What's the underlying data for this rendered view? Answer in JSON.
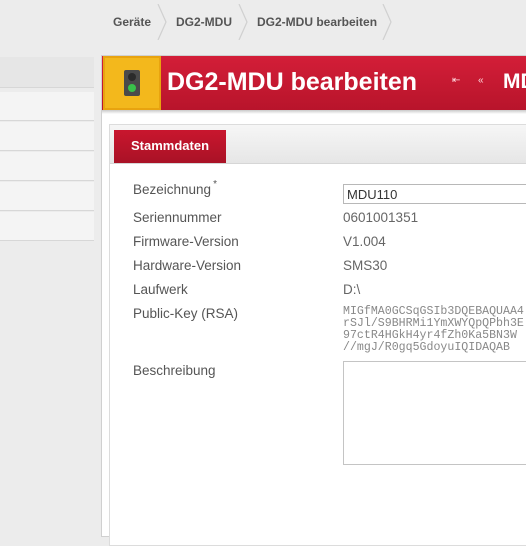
{
  "breadcrumb": {
    "items": [
      "Geräte",
      "DG2-MDU",
      "DG2-MDU bearbeiten"
    ]
  },
  "header": {
    "title": "DG2-MDU bearbeiten",
    "title_overflow": "MD",
    "status_icon": "traffic-light-icon",
    "status_color": "#f3b81c",
    "accent_color": "#c41a33",
    "nav_first_icon": "⇤",
    "nav_prev_icon": "«"
  },
  "tabs": [
    {
      "label": "Stammdaten",
      "active": true
    }
  ],
  "form": {
    "bezeichnung": {
      "label": "Bezeichnung",
      "required_marker": "*",
      "value": "MDU110"
    },
    "seriennummer": {
      "label": "Seriennummer",
      "value": "0601001351"
    },
    "firmware": {
      "label": "Firmware-Version",
      "value": "V1.004"
    },
    "hardware": {
      "label": "Hardware-Version",
      "value": "SMS30"
    },
    "laufwerk": {
      "label": "Laufwerk",
      "value": "D:\\"
    },
    "public_key": {
      "label": "Public-Key (RSA)",
      "lines": [
        "MIGfMA0GCSqGSIb3DQEBAQUAA4",
        "rSJl/S9BHRMi1YmXWYQpQPbh3E",
        "97ctR4HGkH4yr4fZh0Ka5BN3W",
        "//mgJ/R0gq5GdoyuIQIDAQAB"
      ]
    },
    "beschreibung": {
      "label": "Beschreibung",
      "value": ""
    }
  }
}
